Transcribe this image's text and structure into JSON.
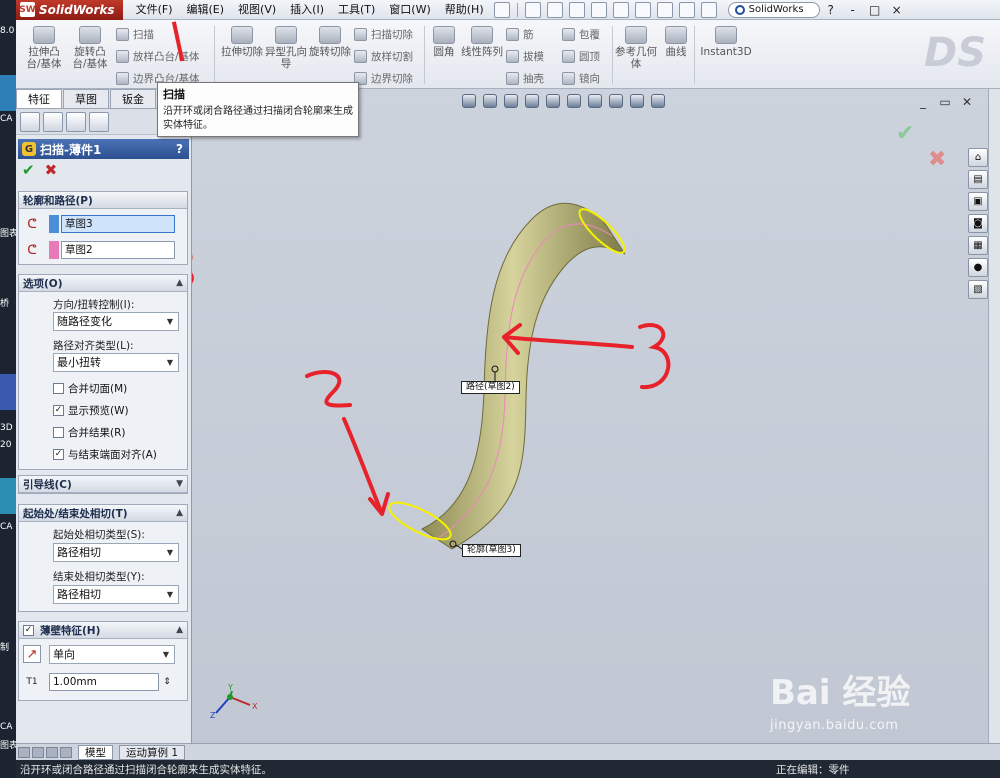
{
  "app": {
    "name": "SolidWorks",
    "logo_mark": "SW"
  },
  "menu": [
    "文件(F)",
    "编辑(E)",
    "视图(V)",
    "插入(I)",
    "工具(T)",
    "窗口(W)",
    "帮助(H)"
  ],
  "search": {
    "value": "SolidWorks"
  },
  "window_controls": [
    "?",
    "-",
    "□",
    "×"
  ],
  "ribbon": {
    "big": [
      {
        "id": "extrude-boss",
        "label": "拉伸凸台/基体"
      },
      {
        "id": "revolve-boss",
        "label": "旋转凸台/基体"
      },
      {
        "id": "extrude-cut",
        "label": "拉伸切除"
      },
      {
        "id": "hole-wizard",
        "label": "异型孔向导"
      },
      {
        "id": "revolve-cut",
        "label": "旋转切除"
      },
      {
        "id": "fillet",
        "label": "圆角"
      },
      {
        "id": "linear-pattern",
        "label": "线性阵列"
      },
      {
        "id": "ref-geometry",
        "label": "参考几何体"
      },
      {
        "id": "curves",
        "label": "曲线"
      },
      {
        "id": "instant3d",
        "label": "Instant3D"
      }
    ],
    "small": [
      {
        "id": "sweep",
        "label": "扫描"
      },
      {
        "id": "loft",
        "label": "放样凸台/基体"
      },
      {
        "id": "boundary",
        "label": "边界凸台/基体"
      },
      {
        "id": "swept-cut",
        "label": "扫描切除"
      },
      {
        "id": "lofted-cut",
        "label": "放样切割"
      },
      {
        "id": "boundary-cut",
        "label": "边界切除"
      },
      {
        "id": "rib",
        "label": "筋"
      },
      {
        "id": "draft",
        "label": "拔模"
      },
      {
        "id": "shell",
        "label": "抽壳"
      },
      {
        "id": "wrap",
        "label": "包覆"
      },
      {
        "id": "dome",
        "label": "圆顶"
      },
      {
        "id": "mirror",
        "label": "镜向"
      }
    ]
  },
  "tabs": [
    "特征",
    "草图",
    "钣金"
  ],
  "tooltip": {
    "title": "扫描",
    "body": "沿开环或闭合路径通过扫描闭合轮廓来生成实体特征。"
  },
  "property_manager": {
    "title": "扫描-薄件1",
    "help": "?",
    "ok": "✔",
    "cancel": "✖",
    "profile_path": {
      "header": "轮廓和路径(P)",
      "profile": "草图3",
      "path": "草图2",
      "profile_color": "#4a90d9",
      "path_color": "#e87ab8"
    },
    "options": {
      "header": "选项(O)",
      "orientation_label": "方向/扭转控制(I):",
      "orientation_value": "随路径变化",
      "path_align_label": "路径对齐类型(L):",
      "path_align_value": "最小扭转",
      "checks": [
        {
          "label": "合并切面(M)",
          "checked": false
        },
        {
          "label": "显示预览(W)",
          "checked": true
        },
        {
          "label": "合并结果(R)",
          "checked": false
        },
        {
          "label": "与结束端面对齐(A)",
          "checked": true
        }
      ]
    },
    "guide_curves": {
      "header": "引导线(C)"
    },
    "tangency": {
      "header": "起始处/结束处相切(T)",
      "start_label": "起始处相切类型(S):",
      "start_value": "路径相切",
      "end_label": "结束处相切类型(Y):",
      "end_value": "路径相切"
    },
    "thin_feature": {
      "header": "薄壁特征(H)",
      "direction_value": "单向",
      "thickness_value": "1.00mm"
    }
  },
  "viewport": {
    "callout_path": "路径(草图2)",
    "callout_profile": "轮廓(草图3)",
    "annotations": [
      "1",
      "2",
      "3",
      "3",
      "2"
    ],
    "axis_labels": {
      "x": "X",
      "y": "Y",
      "z": "Z"
    }
  },
  "bottom_tabs": [
    "模型",
    "运动算例 1"
  ],
  "status": {
    "left": "沿开环或闭合路径通过扫描闭合轮廓来生成实体特征。",
    "right": "正在编辑：零件"
  },
  "desktop": [
    "8.0",
    "CA",
    "图表",
    "桥",
    "3D",
    "20",
    "CA",
    "制",
    "CA",
    "图表"
  ],
  "watermark": {
    "main": "Bai 经验",
    "sub": "jingyan.baidu.com"
  },
  "colors": {
    "title_accent": "#2c4f8f",
    "sweep_body": "#b5b37a",
    "annotation_red": "#e8222a",
    "profile_ellipse": "#f5f000"
  }
}
